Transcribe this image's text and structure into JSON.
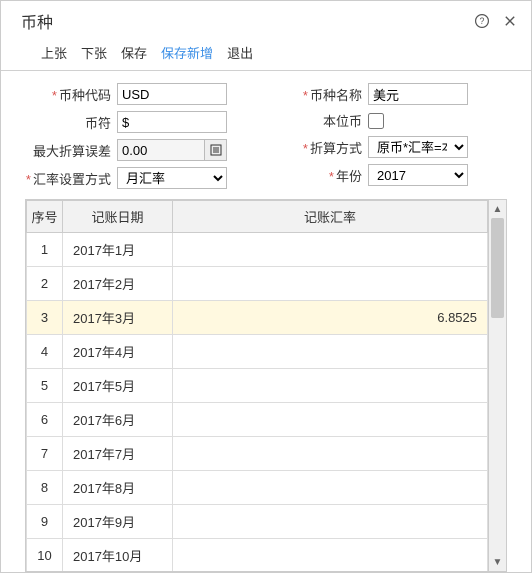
{
  "dialog": {
    "title": "币种"
  },
  "toolbar": {
    "prev": "上张",
    "next": "下张",
    "save": "保存",
    "save_new": "保存新增",
    "exit": "退出"
  },
  "form": {
    "code_label": "币种代码",
    "code_value": "USD",
    "name_label": "币种名称",
    "name_value": "美元",
    "symbol_label": "币符",
    "symbol_value": "$",
    "base_label": "本位币",
    "base_checked": false,
    "max_err_label": "最大折算误差",
    "max_err_value": "0.00",
    "calc_label": "折算方式",
    "calc_value": "原币*汇率=本位币",
    "rate_mode_label": "汇率设置方式",
    "rate_mode_value": "月汇率",
    "year_label": "年份",
    "year_value": "2017"
  },
  "table": {
    "col_seq": "序号",
    "col_date": "记账日期",
    "col_rate": "记账汇率",
    "rows": [
      {
        "seq": "1",
        "date": "2017年1月",
        "rate": ""
      },
      {
        "seq": "2",
        "date": "2017年2月",
        "rate": ""
      },
      {
        "seq": "3",
        "date": "2017年3月",
        "rate": "6.8525",
        "highlight": true
      },
      {
        "seq": "4",
        "date": "2017年4月",
        "rate": ""
      },
      {
        "seq": "5",
        "date": "2017年5月",
        "rate": ""
      },
      {
        "seq": "6",
        "date": "2017年6月",
        "rate": ""
      },
      {
        "seq": "7",
        "date": "2017年7月",
        "rate": ""
      },
      {
        "seq": "8",
        "date": "2017年8月",
        "rate": ""
      },
      {
        "seq": "9",
        "date": "2017年9月",
        "rate": ""
      },
      {
        "seq": "10",
        "date": "2017年10月",
        "rate": ""
      }
    ]
  }
}
